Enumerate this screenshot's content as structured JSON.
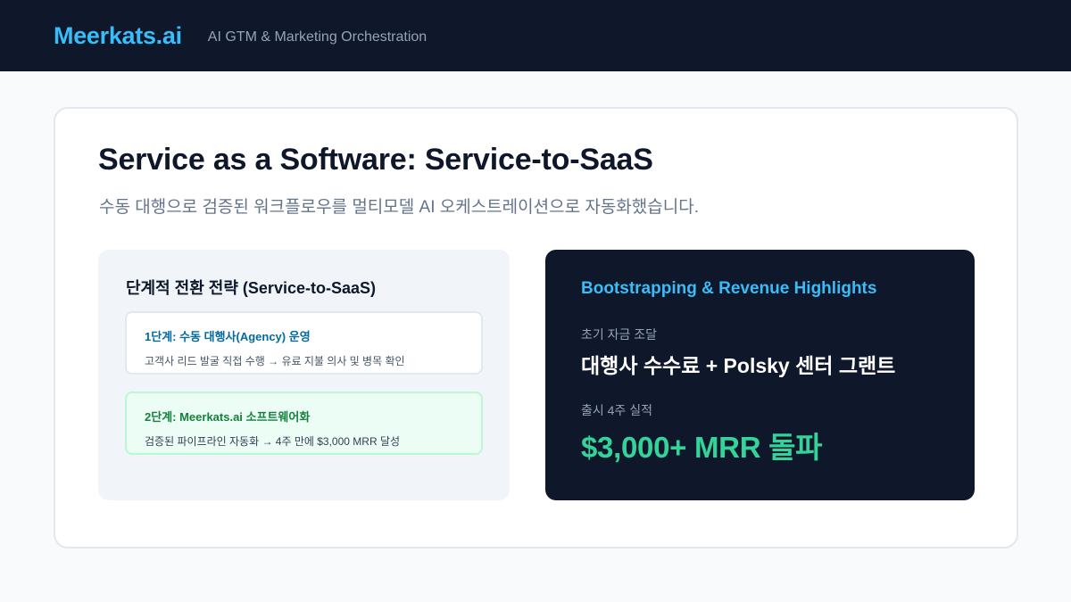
{
  "header": {
    "brand": "Meerkats.ai",
    "tagline": "AI GTM & Marketing Orchestration"
  },
  "main": {
    "title": "Service as a Software: Service-to-SaaS",
    "subtitle": "수동 대행으로 검증된 워크플로우를 멀티모델 AI 오케스트레이션으로 자동화했습니다."
  },
  "strategy": {
    "heading": "단계적 전환 전략 (Service-to-SaaS)",
    "stages": [
      {
        "title": "1단계: 수동 대행사(Agency) 운영",
        "description": "고객사 리드 발굴 직접 수행 → 유료 지불 의사 및 병목 확인"
      },
      {
        "title": "2단계: Meerkats.ai 소프트웨어화",
        "description": "검증된 파이프라인 자동화 → 4주 만에 $3,000 MRR 달성"
      }
    ]
  },
  "highlights": {
    "heading": "Bootstrapping & Revenue Highlights",
    "funding_label": "초기 자금 조달",
    "funding_value": "대행사 수수료 + Polsky 센터 그랜트",
    "launch_label": "출시 4주 실적",
    "launch_value": "$3,000+ MRR 돌파"
  },
  "colors": {
    "brand": "#38bdf8",
    "dark": "#0f172a",
    "accent_green": "#34d399"
  }
}
